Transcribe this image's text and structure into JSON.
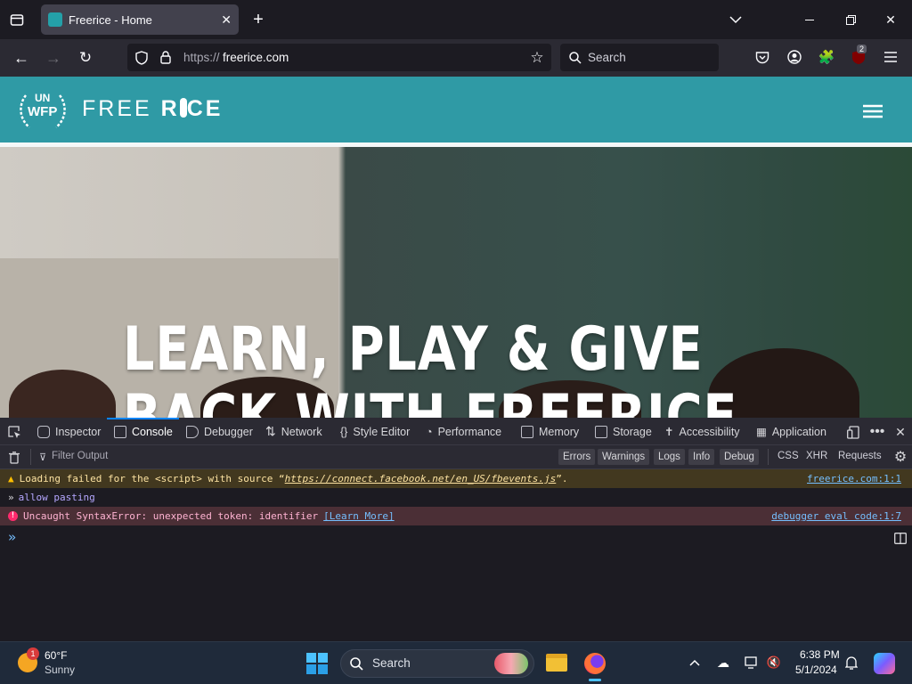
{
  "browser": {
    "tab_title": "Freerice - Home",
    "url_scheme": "https://",
    "url_host": "freerice.com",
    "search_placeholder": "Search",
    "extension_badge": "2"
  },
  "site": {
    "logo_text": "FREE",
    "logo_text2": "R",
    "logo_text3": "CE",
    "wfp_top": "UN",
    "wfp_bottom": "WFP",
    "hero_line1": "LEARN, PLAY & GIVE",
    "hero_line2": "BACK WITH FREERICE"
  },
  "devtools": {
    "tabs": [
      "Inspector",
      "Console",
      "Debugger",
      "Network",
      "Style Editor",
      "Performance",
      "Memory",
      "Storage",
      "Accessibility",
      "Application"
    ],
    "filter_placeholder": "Filter Output",
    "level_chips": [
      "Errors",
      "Warnings",
      "Logs",
      "Info",
      "Debug"
    ],
    "type_filters": [
      "CSS",
      "XHR",
      "Requests"
    ],
    "messages": [
      {
        "kind": "warning",
        "text_pre": "Loading failed for the <script> with source “",
        "text_link": "https://connect.facebook.net/en_US/fbevents.js",
        "text_post": "”.",
        "source": "freerice.com:1:1"
      },
      {
        "kind": "input",
        "text": "allow pasting"
      },
      {
        "kind": "error",
        "text": "Uncaught SyntaxError: unexpected token: identifier",
        "learn_more": "[Learn More]",
        "source": "debugger eval code:1:7"
      }
    ]
  },
  "taskbar": {
    "weather_temp": "60°F",
    "weather_desc": "Sunny",
    "weather_badge": "1",
    "search_label": "Search",
    "time": "6:38 PM",
    "date": "5/1/2024"
  },
  "colors": {
    "site_teal": "#2f9aa5",
    "devtools_accent": "#0a84ff",
    "warning_bg": "#42381f",
    "error_bg": "#4b2f36"
  }
}
